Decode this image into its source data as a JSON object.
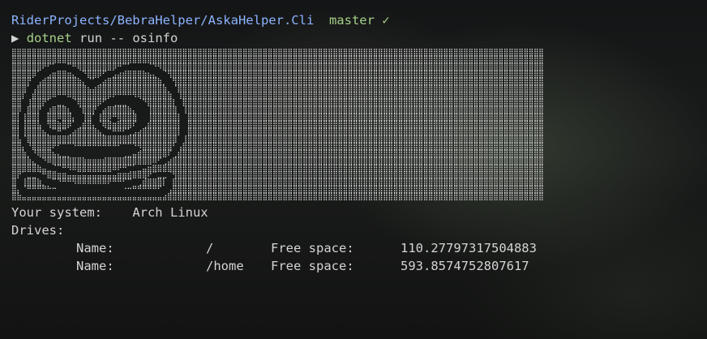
{
  "prompt_line": {
    "path": "RiderProjects/BebraHelper/AskaHelper.Cli",
    "branch": "master",
    "status_icon": "✓"
  },
  "command_line": {
    "prompt_symbol": "▶",
    "command": "dotnet",
    "args": "run -- osinfo"
  },
  "ascii_art_icon": "arch-logo-ascii-art",
  "output": {
    "system_label": "Your system:",
    "system_value": "Arch Linux",
    "drives_label": "Drives:",
    "drives": [
      {
        "name_label": "Name:",
        "name": "/",
        "space_label": "Free space:",
        "space": "110.27797317504883"
      },
      {
        "name_label": "Name:",
        "name": "/home",
        "space_label": "Free space:",
        "space": "593.8574752807617"
      }
    ]
  }
}
